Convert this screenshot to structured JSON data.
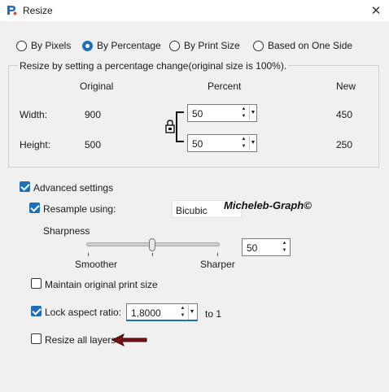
{
  "window": {
    "title": "Resize",
    "close_glyph": "✕"
  },
  "resize_mode": {
    "options": [
      "By Pixels",
      "By Percentage",
      "By Print Size",
      "Based on One Side"
    ],
    "selected": "By Percentage"
  },
  "percentage_group": {
    "legend": "Resize by setting a percentage change(original size is 100%).",
    "headers": {
      "original": "Original",
      "percent": "Percent",
      "new": "New"
    },
    "width": {
      "label": "Width:",
      "original": "900",
      "percent": "50",
      "new": "450"
    },
    "height": {
      "label": "Height:",
      "original": "500",
      "percent": "50",
      "new": "250"
    },
    "lock_icon": "lock-icon"
  },
  "advanced": {
    "label": "Advanced settings",
    "checked": true,
    "resample": {
      "label": "Resample using:",
      "checked": true,
      "value": "Bicubic"
    },
    "sharpness": {
      "label": "Sharpness",
      "value": "50",
      "min_label": "Smoother",
      "max_label": "Sharper",
      "level_percent": 50
    },
    "maintain_print_size": {
      "label": "Maintain original print size",
      "checked": false
    },
    "lock_aspect": {
      "label": "Lock aspect ratio:",
      "checked": true,
      "value": "1,8000",
      "suffix": "to 1"
    },
    "resize_all_layers": {
      "label": "Resize all layers",
      "checked": false
    }
  },
  "watermark_text": "Micheleb-Graph©",
  "colors": {
    "accent": "#1f6fb8",
    "arrow": "#7a0f14",
    "background": "#f0f0f0"
  }
}
